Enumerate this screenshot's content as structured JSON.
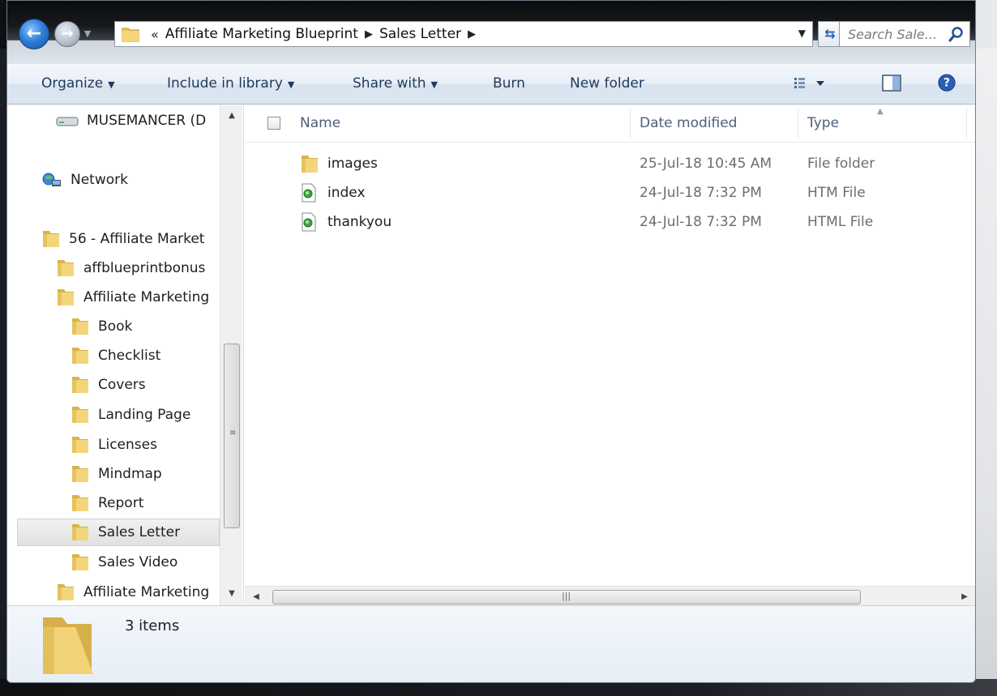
{
  "address": {
    "chevron": "«",
    "breadcrumbs": [
      "Affiliate Marketing Blueprint",
      "Sales Letter"
    ]
  },
  "search": {
    "placeholder": "Search Sale..."
  },
  "toolbar": {
    "organize": "Organize",
    "include_in_library": "Include in library",
    "share_with": "Share with",
    "burn": "Burn",
    "new_folder": "New folder"
  },
  "nav": {
    "items": [
      {
        "label": "MUSEMANCER (D",
        "icon": "drive-icon"
      },
      {
        "label": "Network",
        "icon": "network-icon"
      },
      {
        "label": "56 - Affiliate Market",
        "icon": "folder-icon"
      },
      {
        "label": "affblueprintbonus",
        "icon": "folder-icon"
      },
      {
        "label": "Affiliate Marketing",
        "icon": "folder-icon"
      },
      {
        "label": "Book",
        "icon": "folder-icon"
      },
      {
        "label": "Checklist",
        "icon": "folder-icon"
      },
      {
        "label": "Covers",
        "icon": "folder-icon"
      },
      {
        "label": "Landing Page",
        "icon": "folder-icon"
      },
      {
        "label": "Licenses",
        "icon": "folder-icon"
      },
      {
        "label": "Mindmap",
        "icon": "folder-icon"
      },
      {
        "label": "Report",
        "icon": "folder-icon"
      },
      {
        "label": "Sales Letter",
        "icon": "folder-icon",
        "selected": true
      },
      {
        "label": "Sales Video",
        "icon": "folder-icon"
      },
      {
        "label": "Affiliate Marketing",
        "icon": "folder-icon"
      }
    ]
  },
  "columns": {
    "name": "Name",
    "date_modified": "Date modified",
    "type": "Type"
  },
  "files": [
    {
      "name": "images",
      "date": "25-Jul-18 10:45 AM",
      "type": "File folder",
      "icon": "folder-icon"
    },
    {
      "name": "index",
      "date": "24-Jul-18 7:32 PM",
      "type": "HTM File",
      "icon": "html-file-icon"
    },
    {
      "name": "thankyou",
      "date": "24-Jul-18 7:32 PM",
      "type": "HTML File",
      "icon": "html-file-icon"
    }
  ],
  "details": {
    "count": "3 items"
  },
  "colors": {
    "toolbar_text": "#1e395b",
    "column_header": "#4c607a",
    "meta_text": "#6d6d6d",
    "accent": "#2f7fd8"
  }
}
